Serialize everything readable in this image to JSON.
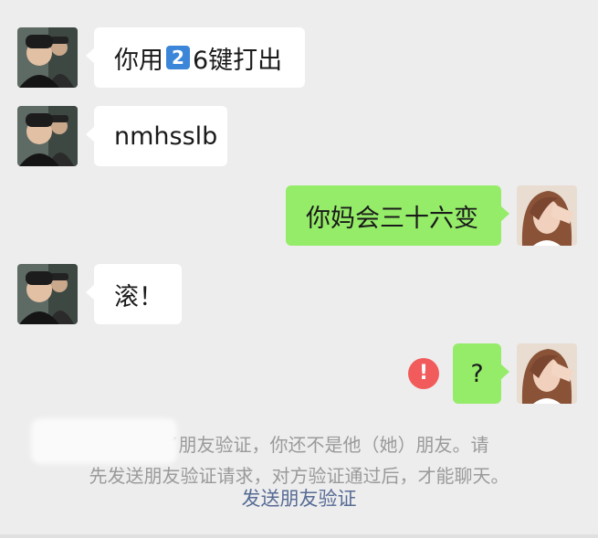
{
  "messages": [
    {
      "side": "left",
      "text_before": "你用",
      "key": "2",
      "text_after": "6键打出"
    },
    {
      "side": "left",
      "text": "nmhsslb"
    },
    {
      "side": "right",
      "text": "你妈会三十六变"
    },
    {
      "side": "left",
      "text": "滚！"
    },
    {
      "side": "right",
      "text": "?"
    }
  ],
  "system_notice": {
    "line1_visible": "了朋友验证，你还不是他（她）朋友。请",
    "line2": "先发送朋友验证请求，对方验证通过后，才能聊天。",
    "link": "发送朋友验证"
  },
  "colors": {
    "background": "#ededed",
    "incoming_bubble": "#ffffff",
    "outgoing_bubble": "#95ec69",
    "link": "#576b95",
    "error": "#f25b5b"
  },
  "icons": {
    "error": "exclamation-circle-icon"
  }
}
